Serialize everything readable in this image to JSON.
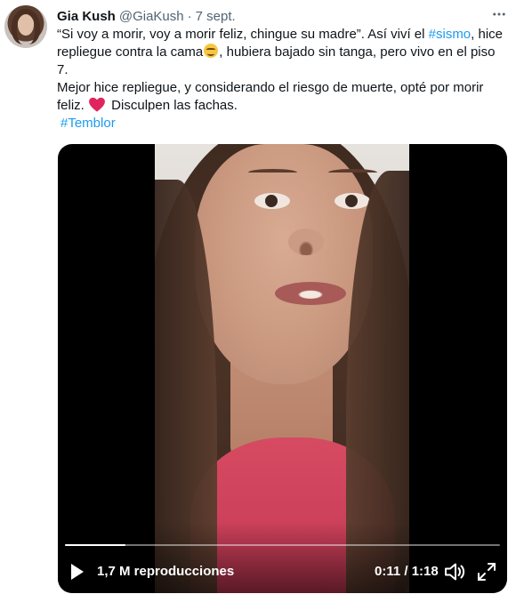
{
  "tweet": {
    "author_name": "Gia Kush",
    "author_handle": "@GiaKush",
    "separator": "·",
    "date": "7 sept.",
    "text": {
      "line1_a": "“Si voy a morir, voy a morir feliz, chingue su madre”. Así viví el ",
      "line1_hashtag": "#sismo",
      "line1_b": ", hice",
      "line2_a": "repliegue contra la cama",
      "line2_emoji": "relieved-face-emoji",
      "line2_b": ", hubiera bajado sin tanga, pero vivo en el piso",
      "line3": "7.",
      "line4": "Mejor hice repliegue, y considerando el riesgo de muerte, opté por morir",
      "line5_a": "feliz. ",
      "line5_emoji": "red-heart-emoji",
      "line5_b": " Disculpen las fachas.",
      "hashtag2": "#Temblor"
    },
    "video": {
      "views": "1,7 M reproducciones",
      "time": "0:11 / 1:18",
      "progress": 0.14
    }
  },
  "colors": {
    "text": "#0f1419",
    "secondary": "#536471",
    "link": "#1d9bf0",
    "heart": "#e0245e",
    "video_bg": "#000000",
    "shirt": "#c23652"
  },
  "icons": {
    "more": "more-dots-icon",
    "play": "play-icon",
    "volume": "volume-icon",
    "fullscreen": "fullscreen-icon"
  }
}
